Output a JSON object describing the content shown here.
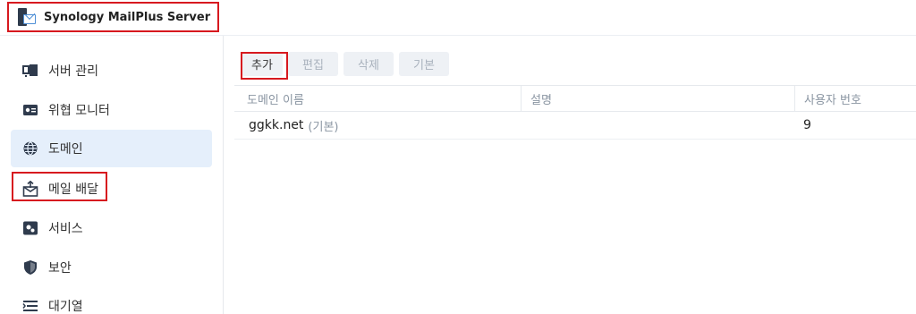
{
  "app": {
    "title": "Synology MailPlus Server"
  },
  "sidebar": {
    "items": [
      {
        "label": "서버 관리",
        "icon": "server-icon"
      },
      {
        "label": "위협 모니터",
        "icon": "monitor-icon"
      },
      {
        "label": "도메인",
        "icon": "globe-icon",
        "active": true
      },
      {
        "label": "메일 배달",
        "icon": "mail-delivery-icon"
      },
      {
        "label": "서비스",
        "icon": "services-icon"
      },
      {
        "label": "보안",
        "icon": "shield-icon"
      },
      {
        "label": "대기열",
        "icon": "queue-icon"
      }
    ]
  },
  "toolbar": {
    "add_label": "추가",
    "edit_label": "편집",
    "delete_label": "삭제",
    "default_label": "기본"
  },
  "table": {
    "columns": [
      "도메인 이름",
      "설명",
      "사용자 번호"
    ],
    "rows": [
      {
        "domain": "ggkk.net",
        "default_tag": "(기본)",
        "description": "",
        "user_count": "9"
      }
    ]
  },
  "colors": {
    "highlight": "#d7191f",
    "active_bg": "#e5effb"
  }
}
